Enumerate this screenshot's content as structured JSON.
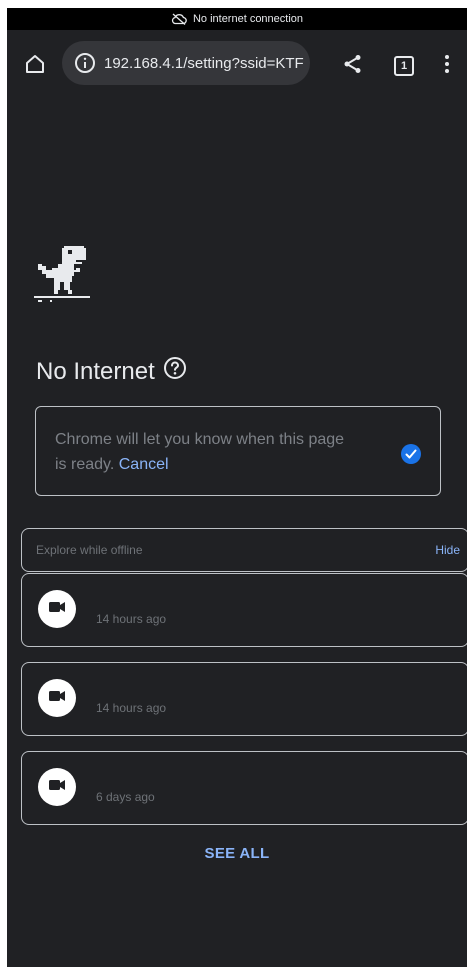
{
  "status_bar": {
    "text": "No internet connection",
    "icon": "cloud-off-icon"
  },
  "toolbar": {
    "home_icon": "home-icon",
    "url": "192.168.4.1/setting?ssid=KTF",
    "info_icon": "info-icon",
    "share_icon": "share-icon",
    "tab_count": "1",
    "menu_icon": "more-vert-icon"
  },
  "page": {
    "dino_icon": "t-rex-dino-icon",
    "title": "No Internet",
    "help_icon": "help-circle-icon",
    "notify": {
      "text": "Chrome will let you know when this page is ready.",
      "cancel_label": "Cancel",
      "check_icon": "checked-circle-icon"
    },
    "explore": {
      "header_label": "Explore while offline",
      "hide_label": "Hide",
      "items": [
        {
          "icon": "video-camera-icon",
          "time": "14 hours ago"
        },
        {
          "icon": "video-camera-icon",
          "time": "14 hours ago"
        },
        {
          "icon": "video-camera-icon",
          "time": "6 days ago"
        }
      ],
      "see_all_label": "SEE ALL"
    }
  },
  "colors": {
    "background": "#202124",
    "status_bar": "#000000",
    "omnibox": "#35363a",
    "text_primary": "#e8eaed",
    "text_secondary": "#7d8187",
    "accent_blue": "#8ab4f8",
    "check_blue": "#1a73e8",
    "border": "#bdc1c6"
  }
}
